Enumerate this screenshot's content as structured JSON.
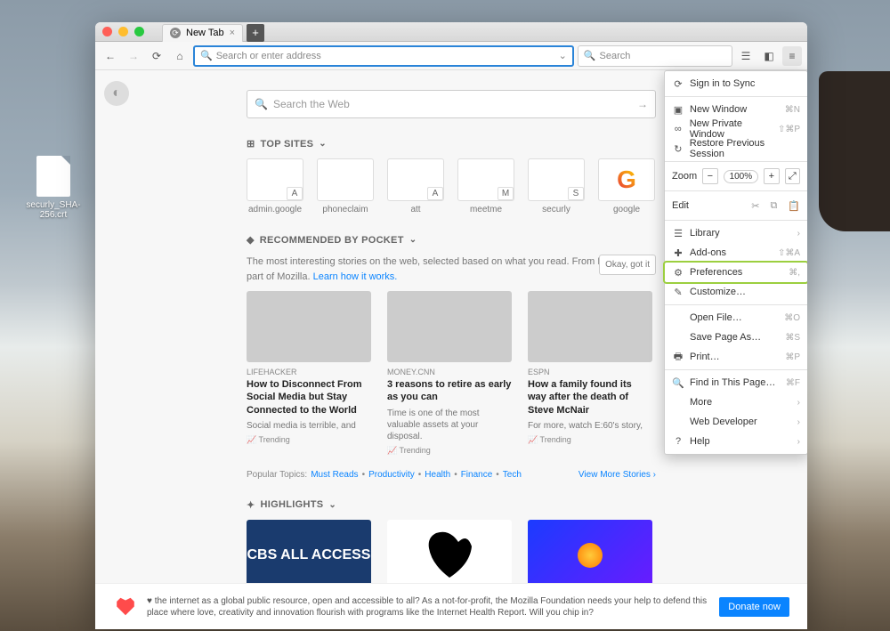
{
  "desktop": {
    "file_label": "securly_SHA-256.crt"
  },
  "tab": {
    "title": "New Tab",
    "close": "×",
    "add": "+"
  },
  "toolbar": {
    "address_placeholder": "Search or enter address",
    "search_placeholder": "Search"
  },
  "websearch": {
    "placeholder": "Search the Web"
  },
  "sections": {
    "topsites": "TOP SITES",
    "pocket": "RECOMMENDED BY POCKET",
    "highlights": "HIGHLIGHTS"
  },
  "topsites": [
    {
      "label": "admin.google",
      "badge": "A"
    },
    {
      "label": "phoneclaim",
      "badge": ""
    },
    {
      "label": "att",
      "badge": "A"
    },
    {
      "label": "meetme",
      "badge": "M"
    },
    {
      "label": "securly",
      "badge": "S"
    },
    {
      "label": "google",
      "badge": ""
    }
  ],
  "pocket": {
    "desc": "The most interesting stories on the web, selected based on what you read. From Pocket, now part of Mozilla. ",
    "link": "Learn how it works.",
    "ok": "Okay, got it"
  },
  "stories": [
    {
      "source": "LIFEHACKER",
      "title": "How to Disconnect From Social Media but Stay Connected to the World",
      "sub": "Social media is terrible, and",
      "trend": "📈 Trending"
    },
    {
      "source": "MONEY.CNN",
      "title": "3 reasons to retire as early as you can",
      "sub": "Time is one of the most valuable assets at your disposal.",
      "trend": "📈 Trending"
    },
    {
      "source": "ESPN",
      "title": "How a family found its way after the death of Steve McNair",
      "sub": "For more, watch E:60's story,",
      "trend": "📈 Trending"
    }
  ],
  "topics": {
    "label": "Popular Topics:",
    "items": [
      "Must Reads",
      "Productivity",
      "Health",
      "Finance",
      "Tech"
    ],
    "more": "View More Stories ›"
  },
  "highlights": [
    {
      "label": "CBS ALL ACCESS"
    },
    {
      "label": ""
    },
    {
      "label": ""
    }
  ],
  "footer": {
    "text": "♥ the internet as a global public resource, open and accessible to all? As a not-for-profit, the Mozilla Foundation needs your help to defend this place where love, creativity and innovation flourish with programs like the Internet Health Report. Will you chip in?",
    "donate": "Donate now"
  },
  "menu": {
    "sync": "Sign in to Sync",
    "new_window": "New Window",
    "new_window_sc": "⌘N",
    "new_private": "New Private Window",
    "new_private_sc": "⇧⌘P",
    "restore": "Restore Previous Session",
    "zoom": "Zoom",
    "zoom_val": "100%",
    "edit": "Edit",
    "library": "Library",
    "addons": "Add-ons",
    "addons_sc": "⇧⌘A",
    "preferences": "Preferences",
    "preferences_sc": "⌘,",
    "customize": "Customize…",
    "open_file": "Open File…",
    "open_file_sc": "⌘O",
    "save_page": "Save Page As…",
    "save_page_sc": "⌘S",
    "print": "Print…",
    "print_sc": "⌘P",
    "find": "Find in This Page…",
    "find_sc": "⌘F",
    "more": "More",
    "webdev": "Web Developer",
    "help": "Help"
  }
}
